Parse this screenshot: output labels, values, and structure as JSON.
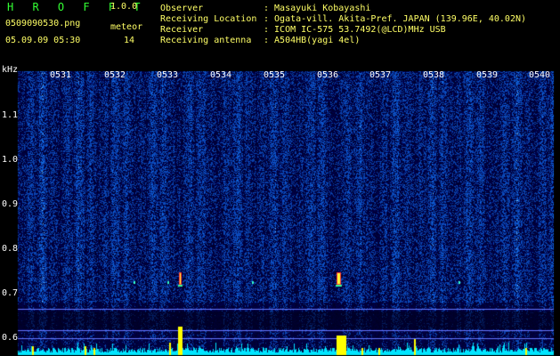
{
  "app": {
    "name": "H R O F F T",
    "version": "1.0.0",
    "filename": "0509090530.png",
    "mode_label": "meteor",
    "timestamp": "05.09.09 05:30",
    "count": "14"
  },
  "info": {
    "labels": [
      "Observer",
      "Receiving Location",
      "Receiver",
      "Receiving antenna"
    ],
    "values": [
      ": Masayuki Kobayashi",
      ": Ogata-vill. Akita-Pref. JAPAN (139.96E, 40.02N)",
      ": ICOM IC-575 53.7492(@LCD)MHz USB",
      ": A504HB(yagi 4el)"
    ]
  },
  "y_axis": {
    "unit": "kHz",
    "ticks": [
      "1.1",
      "1.0",
      "0.9",
      "0.8",
      "0.7",
      "0.6"
    ]
  },
  "x_axis": {
    "ticks": [
      "0531",
      "0532",
      "0533",
      "0534",
      "0535",
      "0536",
      "0537",
      "0538",
      "0539",
      "0540"
    ]
  },
  "colors": {
    "background": "#000000",
    "noise_blue": "#1a33cc",
    "signal_yellow": "#ffff00",
    "header_green": "#33ff33"
  }
}
